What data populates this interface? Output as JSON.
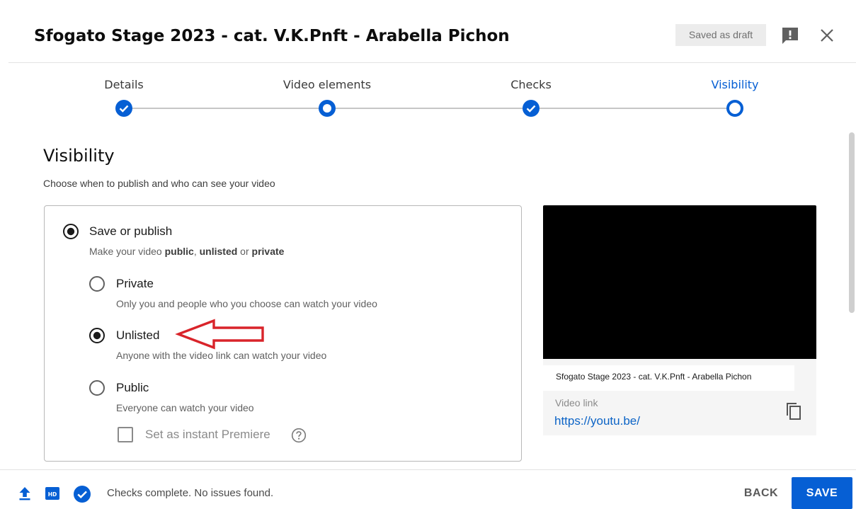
{
  "header": {
    "title": "Sfogato Stage 2023 - cat. V.K.Pnft - Arabella Pichon",
    "draft_status": "Saved as draft"
  },
  "stepper": {
    "steps": [
      {
        "label": "Details",
        "state": "complete"
      },
      {
        "label": "Video elements",
        "state": "visited"
      },
      {
        "label": "Checks",
        "state": "complete"
      },
      {
        "label": "Visibility",
        "state": "current"
      }
    ]
  },
  "visibility": {
    "heading": "Visibility",
    "subtitle": "Choose when to publish and who can see your video",
    "save_or_publish": {
      "label": "Save or publish",
      "selected": true,
      "desc_prefix": "Make your video ",
      "desc_public": "public",
      "desc_sep": ", ",
      "desc_unlisted": "unlisted",
      "desc_or": " or ",
      "desc_private": "private"
    },
    "options": [
      {
        "label": "Private",
        "description": "Only you and people who you choose can watch your video",
        "selected": false
      },
      {
        "label": "Unlisted",
        "description": "Anyone with the video link can watch your video",
        "selected": true
      },
      {
        "label": "Public",
        "description": "Everyone can watch your video",
        "selected": false
      }
    ],
    "instant_premiere": {
      "label": "Set as instant Premiere",
      "checked": false
    }
  },
  "preview": {
    "video_title": "Sfogato Stage 2023 - cat. V.K.Pnft - Arabella Pichon",
    "link_caption": "Video link",
    "link_url": "https://youtu.be/"
  },
  "footer": {
    "status": "Checks complete. No issues found.",
    "back_label": "BACK",
    "save_label": "SAVE"
  },
  "colors": {
    "accent": "#065fd4",
    "annotation_arrow": "#d9242a"
  },
  "icons": [
    "feedback-icon",
    "close-icon",
    "check-icon",
    "help-icon",
    "copy-icon",
    "upload-icon",
    "hd-icon",
    "check-circle-icon"
  ]
}
